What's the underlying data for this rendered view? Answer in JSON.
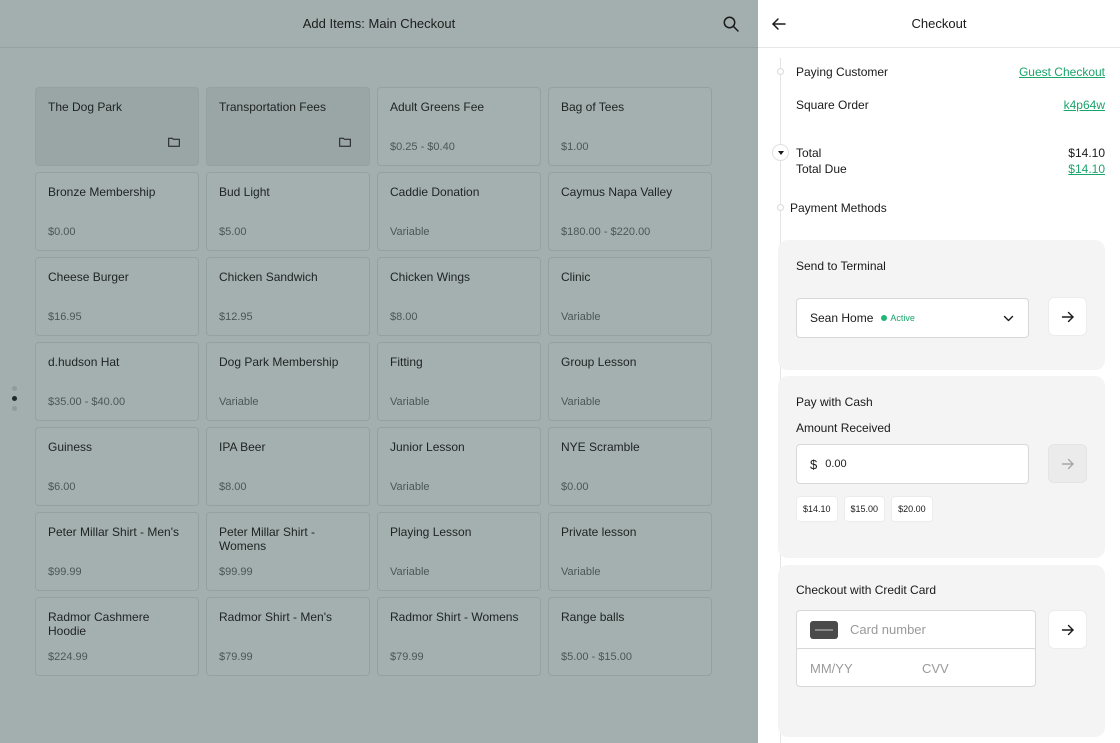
{
  "left": {
    "title": "Add Items: Main Checkout",
    "items": [
      {
        "name": "The Dog Park",
        "price": "",
        "category": true
      },
      {
        "name": "Transportation Fees",
        "price": "",
        "category": true
      },
      {
        "name": "Adult Greens Fee",
        "price": "$0.25 - $0.40"
      },
      {
        "name": "Bag of Tees",
        "price": "$1.00"
      },
      {
        "name": "Bronze Membership",
        "price": "$0.00"
      },
      {
        "name": "Bud Light",
        "price": "$5.00"
      },
      {
        "name": "Caddie Donation",
        "price": "Variable"
      },
      {
        "name": "Caymus Napa Valley",
        "price": "$180.00 - $220.00"
      },
      {
        "name": "Cheese Burger",
        "price": "$16.95"
      },
      {
        "name": "Chicken Sandwich",
        "price": "$12.95"
      },
      {
        "name": "Chicken Wings",
        "price": "$8.00"
      },
      {
        "name": "Clinic",
        "price": "Variable"
      },
      {
        "name": "d.hudson Hat",
        "price": "$35.00 - $40.00"
      },
      {
        "name": "Dog Park Membership",
        "price": "Variable"
      },
      {
        "name": "Fitting",
        "price": "Variable"
      },
      {
        "name": "Group Lesson",
        "price": "Variable"
      },
      {
        "name": "Guiness",
        "price": "$6.00"
      },
      {
        "name": "IPA Beer",
        "price": "$8.00"
      },
      {
        "name": "Junior Lesson",
        "price": "Variable"
      },
      {
        "name": "NYE Scramble",
        "price": "$0.00"
      },
      {
        "name": "Peter Millar Shirt - Men's",
        "price": "$99.99"
      },
      {
        "name": "Peter Millar Shirt - Womens",
        "price": "$99.99"
      },
      {
        "name": "Playing Lesson",
        "price": "Variable"
      },
      {
        "name": "Private lesson",
        "price": "Variable"
      },
      {
        "name": "Radmor Cashmere Hoodie",
        "price": "$224.99"
      },
      {
        "name": "Radmor Shirt - Men's",
        "price": "$79.99"
      },
      {
        "name": "Radmor Shirt - Womens",
        "price": "$79.99"
      },
      {
        "name": "Range balls",
        "price": "$5.00 - $15.00"
      }
    ]
  },
  "checkout": {
    "title": "Checkout",
    "paying_customer_label": "Paying Customer",
    "paying_customer_value": "Guest Checkout",
    "square_order_label": "Square Order",
    "square_order_value": "k4p64w",
    "total_label": "Total",
    "total_value": "$14.10",
    "total_due_label": "Total Due",
    "total_due_value": "$14.10",
    "payment_methods_label": "Payment Methods",
    "terminal": {
      "title": "Send to Terminal",
      "device": "Sean Home",
      "status": "Active"
    },
    "cash": {
      "title": "Pay with Cash",
      "amount_label": "Amount Received",
      "currency_symbol": "$",
      "amount_value": "0.00",
      "quick_amounts": [
        "$14.10",
        "$15.00",
        "$20.00"
      ]
    },
    "credit": {
      "title": "Checkout with Credit Card",
      "card_placeholder": "Card number",
      "expiry_placeholder": "MM/YY",
      "cvv_placeholder": "CVV"
    }
  },
  "colors": {
    "accent_green": "#1aa56a",
    "status_active": "#22b573"
  },
  "icons": {
    "search": "search-icon",
    "back": "arrow-left-icon",
    "folder": "folder-icon",
    "send": "arrow-right-icon",
    "chevron": "chevron-down-icon",
    "card": "credit-card-icon"
  }
}
